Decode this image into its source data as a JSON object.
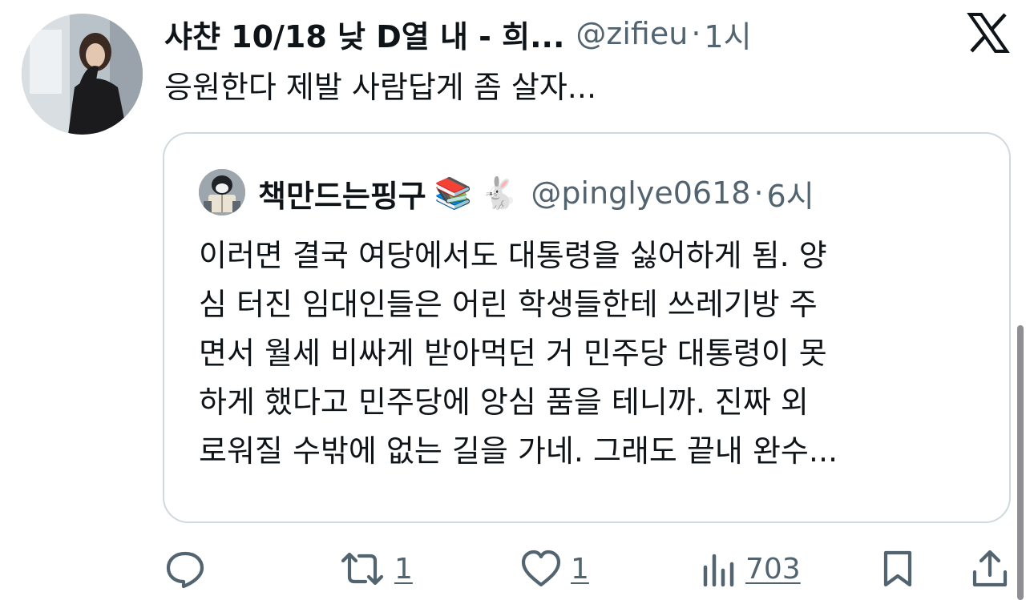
{
  "tweet": {
    "display_name": "샤챤 10/18 낮 D열 내 - 희...",
    "handle": "@zifieu",
    "separator": "·",
    "time": "1시",
    "text": "응원한다 제발 사람답게 좀 살자..."
  },
  "quoted_tweet": {
    "display_name": "책만드는핑구",
    "emoji_books": "📚",
    "emoji_rabbit": "🐇",
    "handle": "@pinglye0618",
    "separator": "·",
    "time": "6시",
    "lines": [
      "이러면 결국 여당에서도 대통령을 싫어하게 됨. 양",
      "심 터진 임대인들은 어린 학생들한테 쓰레기방 주",
      "면서 월세 비싸게 받아먹던 거 민주당 대통령이 못",
      "하게 했다고 민주당에 앙심 품을 테니까. 진짜 외",
      "로워질 수밖에 없는 길을 가네. 그래도 끝내 완수..."
    ]
  },
  "actions": {
    "reply_icon": "speech-bubble-icon",
    "retweet_icon": "retweet-icon",
    "retweet_count": "1",
    "like_icon": "heart-icon",
    "like_count": "1",
    "views_icon": "bar-chart-icon",
    "views_count": "703",
    "bookmark_icon": "bookmark-icon",
    "share_icon": "share-icon"
  },
  "colors": {
    "text_primary": "#0f1419",
    "text_secondary": "#536471",
    "border": "#cfd9de"
  }
}
